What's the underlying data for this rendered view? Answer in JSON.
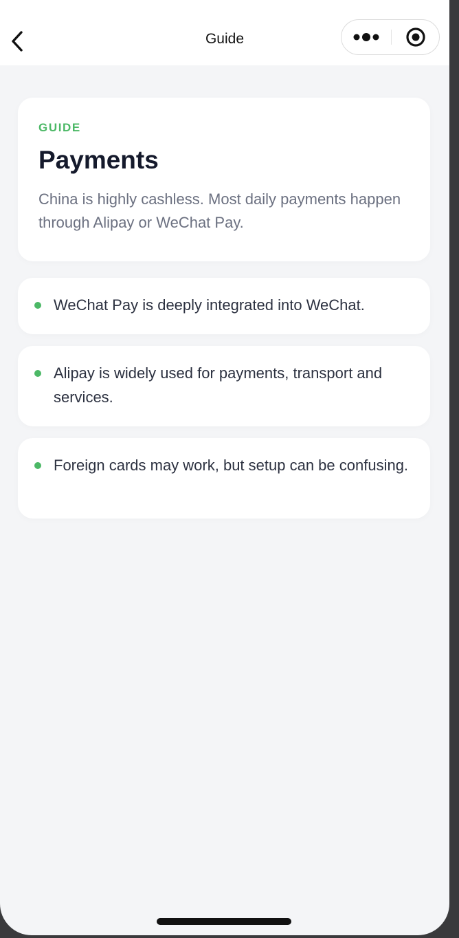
{
  "nav": {
    "title": "Guide",
    "back_icon": "chevron-left-icon",
    "more_icon": "more-dots-icon",
    "close_icon": "target-circle-icon"
  },
  "hero": {
    "eyebrow": "GUIDE",
    "title": "Payments",
    "description": "China is highly cashless. Most daily payments happen through Alipay or WeChat Pay."
  },
  "items": [
    {
      "text": "WeChat Pay is deeply integrated into WeChat."
    },
    {
      "text": "Alipay is widely used for payments, transport and services."
    },
    {
      "text": "Foreign cards may work, but setup can be confusing."
    }
  ],
  "colors": {
    "accent": "#4cb866",
    "background": "#f4f5f7",
    "card": "#ffffff",
    "title": "#151a2c",
    "body_text": "#2c3140",
    "muted_text": "#6b7080"
  }
}
